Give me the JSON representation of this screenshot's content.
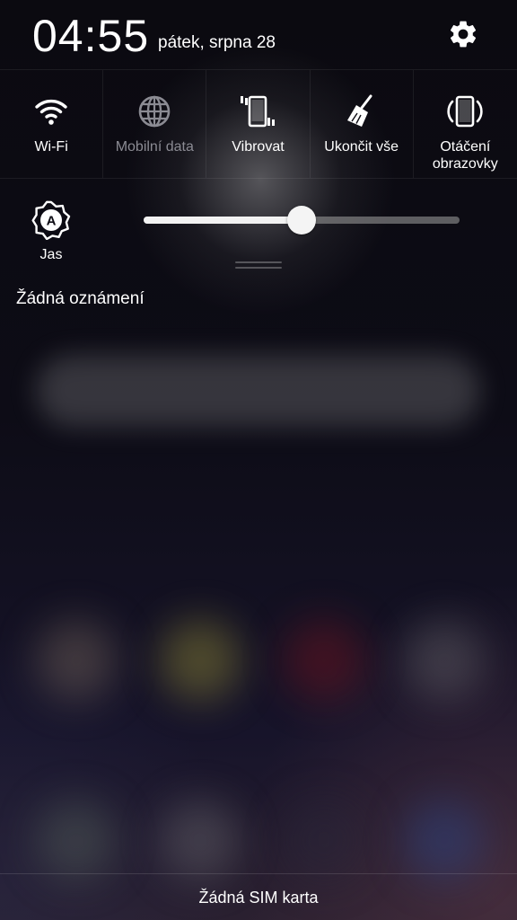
{
  "header": {
    "time": "04:55",
    "date": "pátek, srpna 28",
    "settings_icon": "gear-icon"
  },
  "quick_toggles": [
    {
      "label": "Wi-Fi",
      "icon": "wifi-icon",
      "state": "on"
    },
    {
      "label": "Mobilní data",
      "icon": "globe-icon",
      "state": "off"
    },
    {
      "label": "Vibrovat",
      "icon": "vibrate-icon",
      "state": "on"
    },
    {
      "label": "Ukončit vše",
      "icon": "broom-icon",
      "state": "on"
    },
    {
      "label": "Otáčení obrazovky",
      "icon": "screen-rotation-icon",
      "state": "on"
    }
  ],
  "brightness": {
    "label": "Jas",
    "icon": "auto-brightness-icon",
    "level": 0.5
  },
  "notifications": {
    "empty_text": "Žádná oznámení"
  },
  "footer": {
    "text": "Žádná SIM karta"
  },
  "colors": {
    "active": "#ffffff",
    "inactive": "#8b8b93",
    "background": "#0d0c14"
  }
}
